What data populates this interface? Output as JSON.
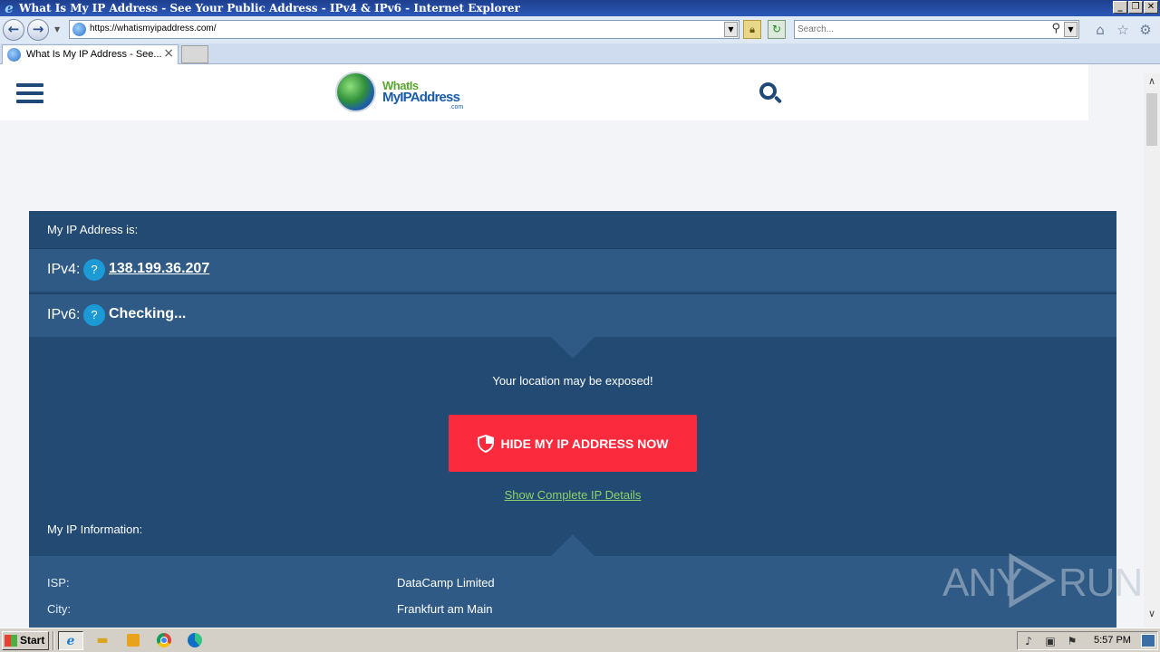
{
  "window": {
    "title": "What Is My IP Address - See Your Public Address - IPv4 & IPv6 - Internet Explorer",
    "buttons": {
      "minimize": "_",
      "restore": "❐",
      "close": "✕"
    }
  },
  "addressbar": {
    "url": "https://whatismyipaddress.com/",
    "search_placeholder": "Search..."
  },
  "tabs": [
    {
      "label": "What Is My IP Address - See...",
      "active": true
    }
  ],
  "site": {
    "logo": {
      "line1": "WhatIs",
      "line2": "MyIPAddress",
      "line3": ".com"
    }
  },
  "ip_card": {
    "heading": "My IP Address is:",
    "ipv4_label": "IPv4:",
    "ipv4_value": "138.199.36.207",
    "ipv6_label": "IPv6:",
    "ipv6_value": "Checking...",
    "help_glyph": "?",
    "exposed_text": "Your location may be exposed!",
    "hide_button": "HIDE MY IP ADDRESS NOW",
    "details_link": "Show Complete IP Details",
    "info_heading": "My IP Information:",
    "info_rows": [
      {
        "key": "ISP:",
        "value": "DataCamp Limited"
      },
      {
        "key": "City:",
        "value": "Frankfurt am Main"
      }
    ]
  },
  "watermark": {
    "text_left": "ANY",
    "text_right": "RUN"
  },
  "taskbar": {
    "start_label": "Start",
    "clock": "5:57 PM"
  },
  "colors": {
    "card_bg": "#224a73",
    "row_bg": "#2e5a85",
    "hide_button_bg": "#fb2b3d",
    "link_green": "#8fd16a",
    "help_blue": "#1b9ad6"
  }
}
